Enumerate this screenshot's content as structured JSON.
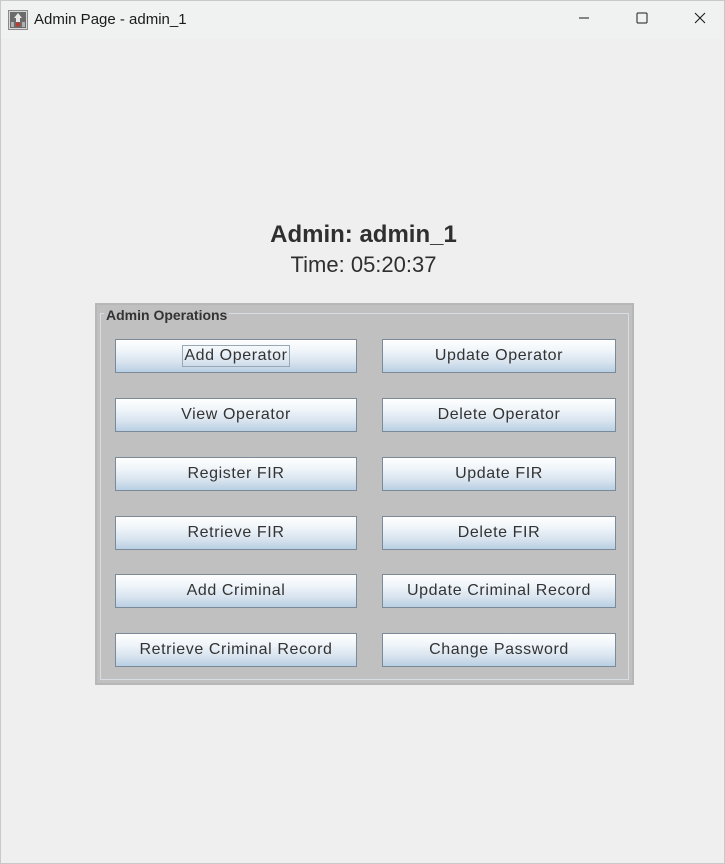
{
  "window": {
    "title": "Admin Page - admin_1",
    "icon": "java-app-icon",
    "controls": [
      "minimize-icon",
      "maximize-icon",
      "close-icon"
    ]
  },
  "header": {
    "admin_label": "Admin: admin_1",
    "time_label": "Time: 05:20:37"
  },
  "operations": {
    "title": "Admin Operations",
    "buttons": {
      "add_operator": "Add Operator",
      "update_operator": "Update Operator",
      "view_operator": "View Operator",
      "delete_operator": "Delete Operator",
      "register_fir": "Register FIR",
      "update_fir": "Update FIR",
      "retrieve_fir": "Retrieve FIR",
      "delete_fir": "Delete FIR",
      "add_criminal": "Add Criminal",
      "update_criminal_record": "Update Criminal Record",
      "retrieve_criminal_record": "Retrieve Criminal Record",
      "change_password": "Change Password"
    },
    "focused_button": "Add Operator"
  },
  "colors": {
    "background": "#efefef",
    "panel": "#c0c0c0",
    "button_border": "#7a8a99",
    "text": "#333333"
  }
}
